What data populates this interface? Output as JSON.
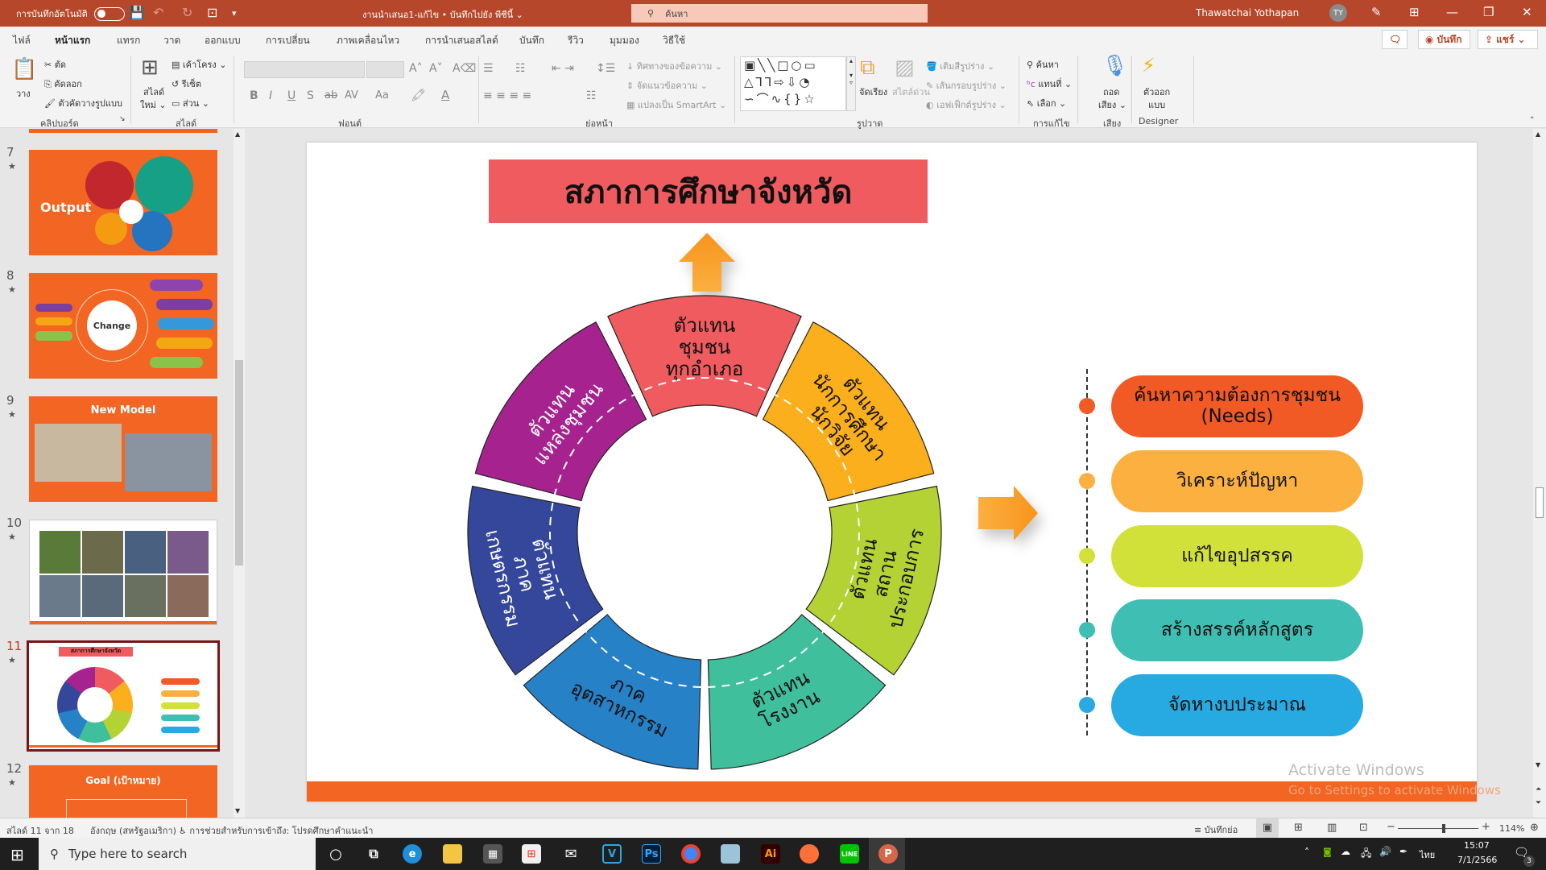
{
  "titlebar": {
    "autosave_label": "การบันทึกอัตโนมัติ",
    "autosave_state": "off",
    "document_title": "งานนำเสนอ1-แก้ไข • บันทึกไปยัง พีซีนี้ ⌄",
    "search_placeholder": "ค้นหา",
    "user_name": "Thawatchai Yothapan",
    "user_initials": "TY"
  },
  "tabs": [
    "ไฟล์",
    "หน้าแรก",
    "แทรก",
    "วาด",
    "ออกแบบ",
    "การเปลี่ยน",
    "ภาพเคลื่อนไหว",
    "การนำเสนอสไลด์",
    "บันทึก",
    "รีวิว",
    "มุมมอง",
    "วิธีใช้"
  ],
  "active_tab": "หน้าแรก",
  "top_right": {
    "record_label": "บันทึก",
    "share_label": "แชร์"
  },
  "ribbon": {
    "clipboard": {
      "paste": "วาง",
      "cut": "ตัด",
      "copy": "คัดลอก",
      "format_painter": "ตัวคัดวางรูปแบบ",
      "group": "คลิปบอร์ด"
    },
    "slides": {
      "new_slide_1": "สไลด์",
      "new_slide_2": "ใหม่ ⌄",
      "layout": "เค้าโครง ⌄",
      "reset": "รีเซ็ต",
      "section": "ส่วน ⌄",
      "group": "สไลด์"
    },
    "font": {
      "font_name": "",
      "font_size": "",
      "bold": "B",
      "italic": "I",
      "underline": "U",
      "shadow": "S",
      "strike": "ab",
      "spacing": "AV",
      "case": "Aa",
      "group": "ฟอนต์"
    },
    "paragraph": {
      "text_direction": "ทิศทางของข้อความ ⌄",
      "align_text": "จัดแนวข้อความ ⌄",
      "smartart": "แปลงเป็น SmartArt ⌄",
      "group": "ย่อหน้า"
    },
    "drawing": {
      "arrange": "จัดเรียง",
      "quick_styles": "สไตล์ด่วน",
      "shape_fill": "เติมสีรูปร่าง ⌄",
      "shape_outline": "เส้นกรอบรูปร่าง ⌄",
      "shape_effects": "เอฟเฟ็กต์รูปร่าง ⌄",
      "group": "รูปวาด"
    },
    "editing": {
      "find": "ค้นหา",
      "replace": "แทนที่ ⌄",
      "select": "เลือก ⌄",
      "group": "การแก้ไข"
    },
    "voice": {
      "dictate_1": "ถอด",
      "dictate_2": "เสียง ⌄",
      "group": "เสียง"
    },
    "designer": {
      "label_1": "ตัวออก",
      "label_2": "แบบ",
      "group": "Designer"
    }
  },
  "thumbnails": [
    {
      "number": "7",
      "title": "Output"
    },
    {
      "number": "8",
      "title": "Change"
    },
    {
      "number": "9",
      "title": "New Model"
    },
    {
      "number": "10",
      "title": ""
    },
    {
      "number": "11",
      "title": "สภาการศึกษาจังหวัด",
      "selected": true
    },
    {
      "number": "12",
      "title": "Goal (เป้าหมาย)"
    }
  ],
  "slide": {
    "title": "สภาการศึกษาจังหวัด",
    "ring_segments": [
      {
        "label": "ตัวแทน ชุมชน ทุกอำเภอ",
        "color": "#ef5b5f"
      },
      {
        "label": "ตัวแทน นักการศึกษา นักวิจัย",
        "color": "#fbaf1c"
      },
      {
        "label": "ตัวแทน สถาน ประกอบการ",
        "color": "#b4d233"
      },
      {
        "label": "ตัวแทน โรงงาน",
        "color": "#3fbf9b"
      },
      {
        "label": "ภาค อุตสาหกรรม",
        "color": "#2781c7"
      },
      {
        "label": "ตัวแทน ภาค เกษตรกรรม",
        "color": "#35479b"
      },
      {
        "label": "ตัวแทน แหล่งชุมชน",
        "color": "#a6238f"
      }
    ],
    "steps": [
      {
        "label": "ค้นหาความต้องการชุมชน (Needs)",
        "color": "#f15a24"
      },
      {
        "label": "วิเคราะห์ปัญหา",
        "color": "#fbb040"
      },
      {
        "label": "แก้ไขอุปสรรค",
        "color": "#d2e03a"
      },
      {
        "label": "สร้างสรรค์หลักสูตร",
        "color": "#3fbfb3"
      },
      {
        "label": "จัดหางบประมาณ",
        "color": "#26aae1"
      }
    ],
    "footer_bar_color": "#f26522"
  },
  "watermark": {
    "line1": "Activate Windows",
    "line2": "Go to Settings to activate Windows"
  },
  "statusbar": {
    "slide_info": "สไลด์ 11 จาก 18",
    "language": "อังกฤษ (สหรัฐอเมริกา)",
    "accessibility": "การช่วยสำหรับการเข้าถึง: โปรดศึกษาคำแนะนำ",
    "notes": "บันทึกย่อ",
    "zoom": "114%",
    "zoom_level": 0.57
  },
  "taskbar": {
    "search_placeholder": "Type here to search",
    "apps": [
      "cortana",
      "task-view",
      "edge",
      "file-explorer",
      "calculator",
      "store",
      "mail",
      "vegas",
      "photoshop",
      "chrome",
      "notepad",
      "illustrator",
      "firefox",
      "line",
      "powerpoint"
    ],
    "language": "ไทย",
    "time": "15:07",
    "date": "7/1/2566",
    "notifications": "3"
  }
}
